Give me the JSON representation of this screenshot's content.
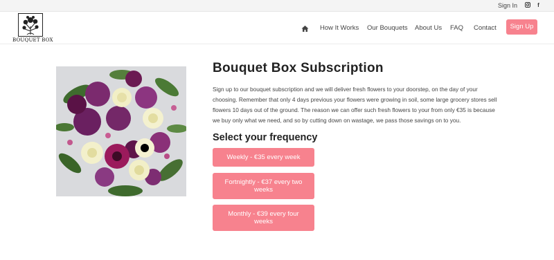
{
  "topbar": {
    "signin_label": "Sign In",
    "social_icons": [
      "instagram-icon",
      "facebook-icon"
    ]
  },
  "logo": {
    "text": "BOUQUET BOX"
  },
  "nav": {
    "home_icon": "home-icon",
    "items": [
      {
        "label": "How It Works"
      },
      {
        "label": "Our Bouquets"
      },
      {
        "label": "About Us"
      },
      {
        "label": "FAQ"
      },
      {
        "label": "Contact"
      }
    ],
    "signup_label": "Sign Up"
  },
  "main": {
    "title": "Bouquet Box Subscription",
    "intro": "Sign up to our bouquet subscription and we will deliver fresh flowers to your doorstep, on the day of your choosing.  Remember that only 4 days previous your flowers were growing in soil, some large grocery stores sell flowers 10 days out of the ground. The reason we can offer such fresh flowers to your from only €35 is because we buy only what we need, and so by cutting down on wastage, we pass those savings on to you.",
    "frequency_title": "Select your frequency",
    "options": [
      {
        "label": "Weekly - €35 every week"
      },
      {
        "label": "Fortnightly - €37 every two weeks"
      },
      {
        "label": "Monthly - €39 every four weeks"
      }
    ]
  },
  "colors": {
    "accent": "#f7828e",
    "topbar_bg": "#f4f4f4",
    "text": "#444444"
  }
}
